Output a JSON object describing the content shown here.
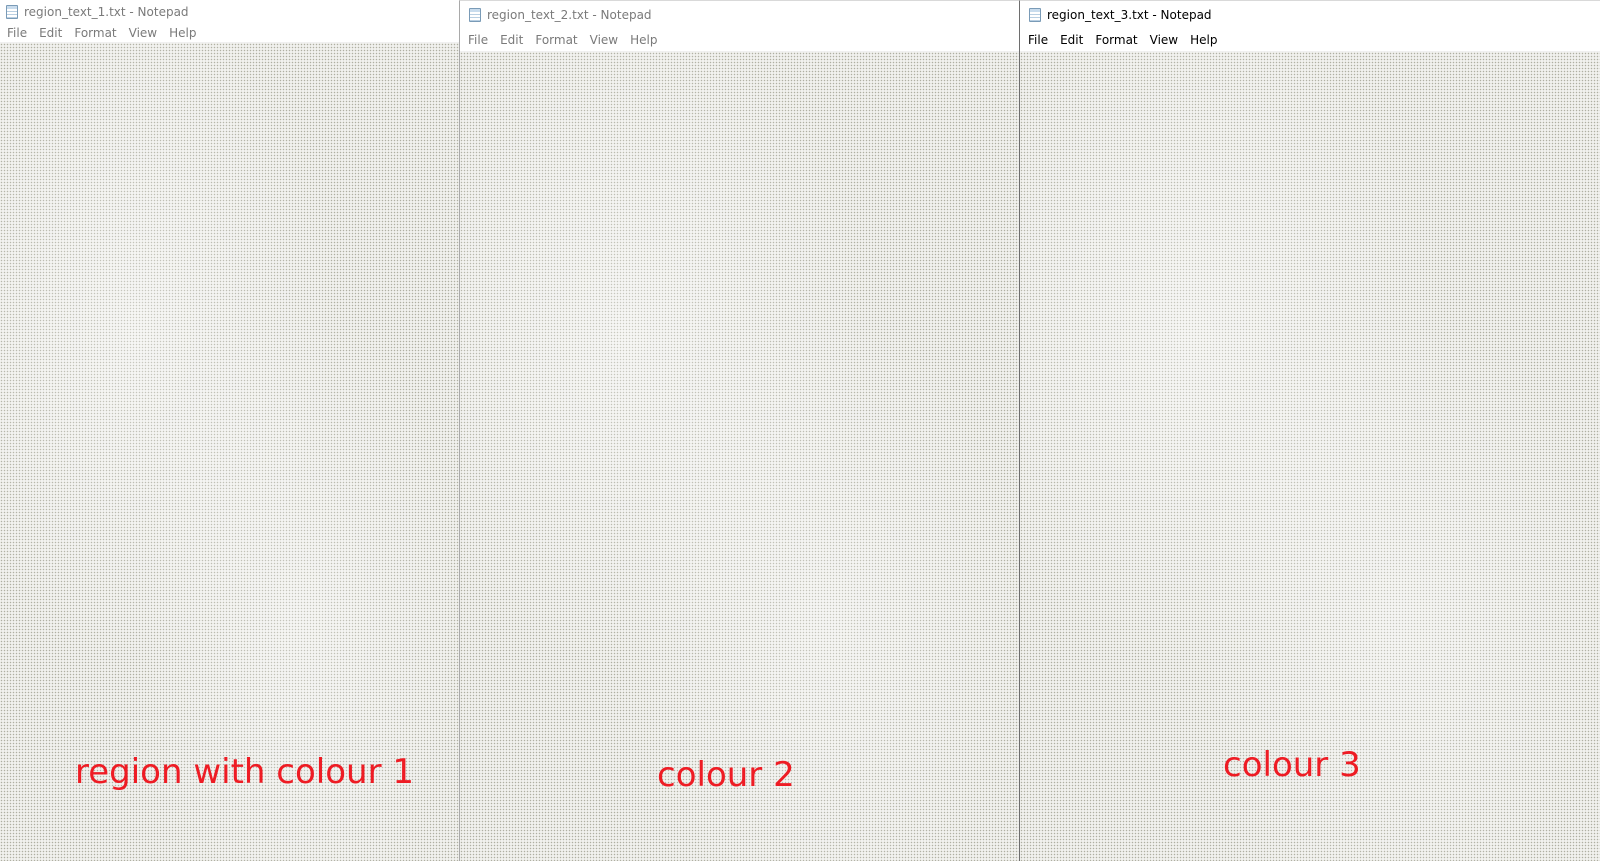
{
  "windows": [
    {
      "title": "region_text_1.txt - Notepad",
      "state": "inactive",
      "menu": [
        "File",
        "Edit",
        "Format",
        "View",
        "Help"
      ]
    },
    {
      "title": "region_text_2.txt - Notepad",
      "state": "inactive",
      "menu": [
        "File",
        "Edit",
        "Format",
        "View",
        "Help"
      ]
    },
    {
      "title": "region_text_3.txt - Notepad",
      "state": "active",
      "menu": [
        "File",
        "Edit",
        "Format",
        "View",
        "Help"
      ]
    }
  ],
  "annotations": [
    "region with colour 1",
    "colour 2",
    "colour 3"
  ],
  "colors": {
    "annotation": "#ee1c24",
    "editor_background": "#f1f1ee",
    "inactive_text": "#7a7a7a",
    "active_text": "#000000"
  }
}
